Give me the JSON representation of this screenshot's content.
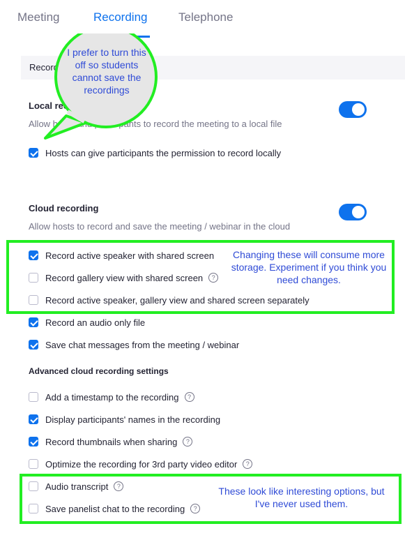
{
  "tabs": [
    "Meeting",
    "Recording",
    "Telephone"
  ],
  "section_header": "Recording",
  "local": {
    "title": "Local recording",
    "desc": "Allow hosts and participants to record the meeting to a local file",
    "toggle_on": true,
    "option": {
      "label": "Hosts can give participants the permission to record locally",
      "checked": true
    }
  },
  "cloud": {
    "title": "Cloud recording",
    "desc": "Allow hosts to record and save the meeting / webinar in the cloud",
    "toggle_on": true,
    "options": [
      {
        "label": "Record active speaker with shared screen",
        "checked": true
      },
      {
        "label": "Record gallery view with shared screen",
        "checked": false,
        "help": "?"
      },
      {
        "label": "Record active speaker, gallery view and shared screen separately",
        "checked": false
      },
      {
        "label": "Record an audio only file",
        "checked": true
      },
      {
        "label": "Save chat messages from the meeting / webinar",
        "checked": true
      }
    ]
  },
  "advanced": {
    "title": "Advanced cloud recording settings",
    "options": [
      {
        "label": "Add a timestamp to the recording",
        "checked": false,
        "help": "?"
      },
      {
        "label": "Display participants' names in the recording",
        "checked": true
      },
      {
        "label": "Record thumbnails when sharing",
        "checked": true,
        "help": "?"
      },
      {
        "label": "Optimize the recording for 3rd party video editor",
        "checked": false,
        "help": "?"
      },
      {
        "label": "Audio transcript",
        "checked": false,
        "help": "?"
      },
      {
        "label": "Save panelist chat to the recording",
        "checked": false,
        "help": "?"
      }
    ]
  },
  "annotations": {
    "bubble": "I prefer to turn this off so students cannot save the recordings",
    "storage_note": "Changing these will consume more storage. Experiment if you think you need changes.",
    "options_note": "These look like interesting options, but I've never used them."
  },
  "colors": {
    "accent": "#0e72ed",
    "highlight": "#22ee22",
    "annotation_text": "#2f4bd6"
  }
}
